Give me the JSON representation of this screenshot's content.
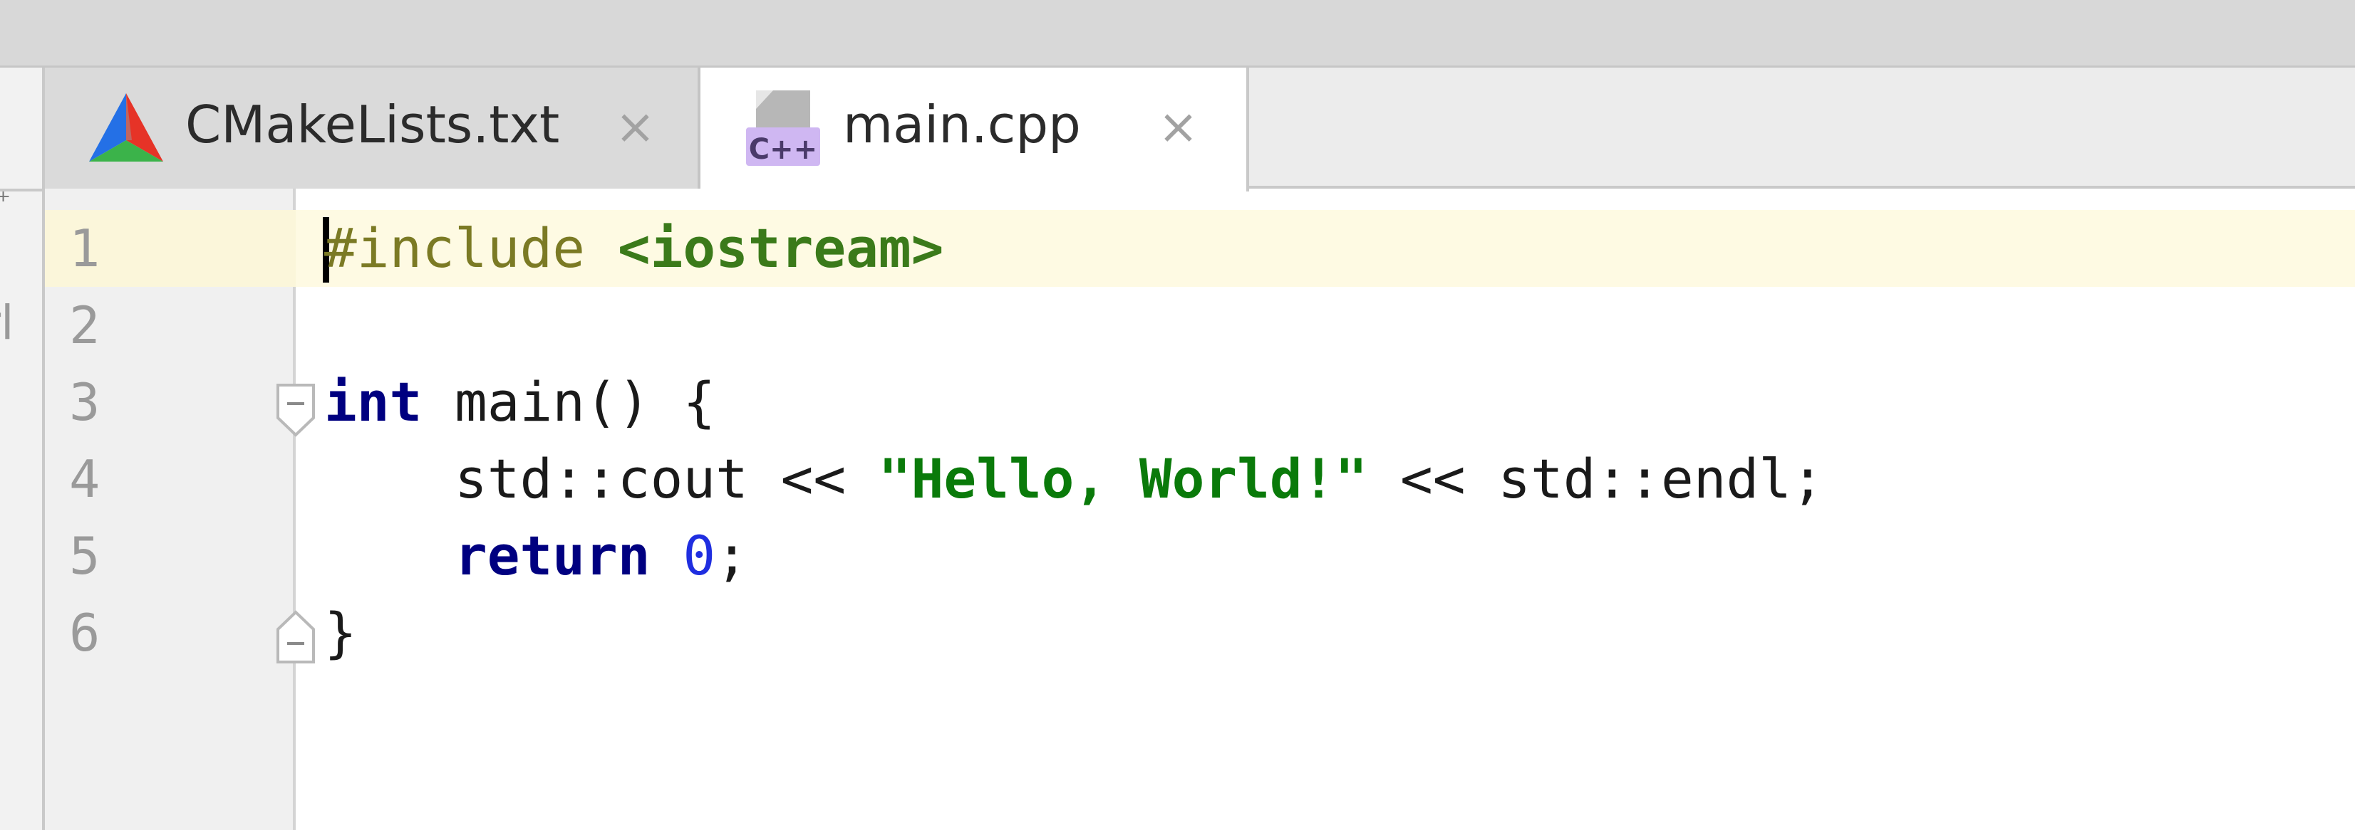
{
  "tabs": [
    {
      "label": "CMakeLists.txt",
      "icon": "cmake-icon",
      "active": false
    },
    {
      "label": "main.cpp",
      "icon": "cpp-file-icon",
      "active": true
    }
  ],
  "left_panel": {
    "partial_text": "rl"
  },
  "close_glyph": "×",
  "gutter": {
    "line_numbers": [
      "1",
      "2",
      "3",
      "4",
      "5",
      "6"
    ]
  },
  "code": {
    "line1": {
      "directive": "#include",
      "header": "<iostream>"
    },
    "line3": {
      "keyword": "int",
      "rest": " main() {"
    },
    "line4": {
      "indent": "    ",
      "pre": "std::cout << ",
      "string": "\"Hello, World!\"",
      "post": " << std::endl;"
    },
    "line5": {
      "indent": "    ",
      "keyword": "return",
      "space": " ",
      "number": "0",
      "semi": ";"
    },
    "line6": {
      "text": "}"
    }
  },
  "colors": {
    "keyword": "#000080",
    "string": "#0a7a0a",
    "number": "#1f2ee0",
    "preprocessor": "#7b7a24",
    "current_line": "#fefae3"
  }
}
